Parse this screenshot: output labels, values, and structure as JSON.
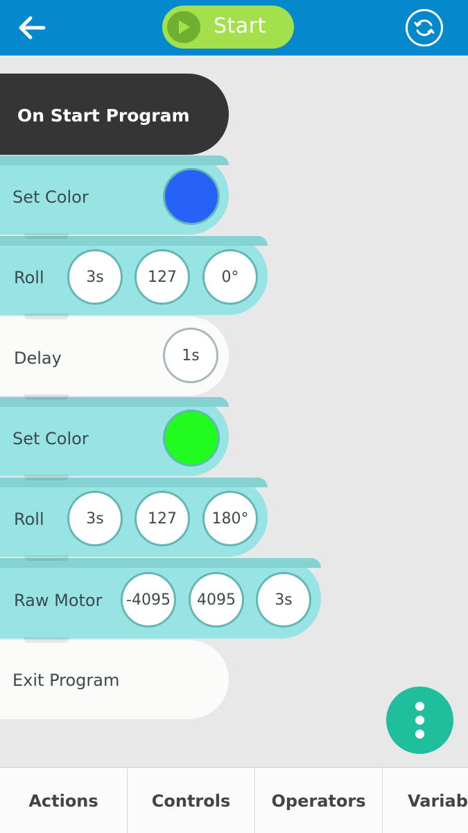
{
  "header": {
    "start_label": "Start",
    "colors": {
      "bar": "#0588cc",
      "start": "#a3e04c"
    }
  },
  "program": {
    "hat_label": "On Start Program",
    "blocks": [
      {
        "type": "set-color",
        "label": "Set Color",
        "color": "#2762f8"
      },
      {
        "type": "roll",
        "label": "Roll",
        "params": [
          "3s",
          "127",
          "0°"
        ]
      },
      {
        "type": "delay",
        "label": "Delay",
        "params": [
          "1s"
        ]
      },
      {
        "type": "set-color",
        "label": "Set Color",
        "color": "#22fb1f"
      },
      {
        "type": "roll",
        "label": "Roll",
        "params": [
          "3s",
          "127",
          "180°"
        ]
      },
      {
        "type": "raw-motor",
        "label": "Raw Motor",
        "params": [
          "-4095",
          "4095",
          "3s"
        ]
      },
      {
        "type": "exit",
        "label": "Exit Program"
      }
    ]
  },
  "tabs": [
    "Actions",
    "Controls",
    "Operators",
    "Variables"
  ]
}
